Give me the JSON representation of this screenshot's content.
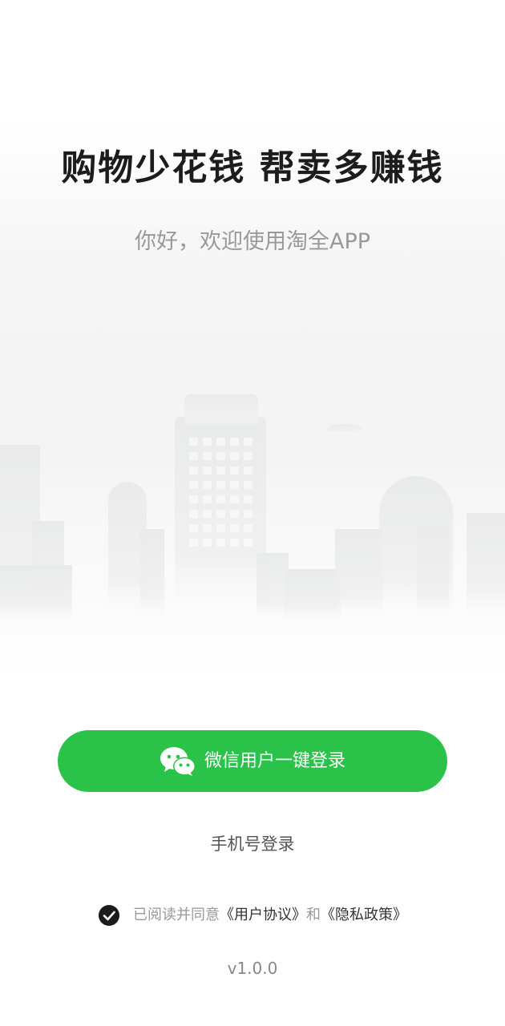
{
  "hero": {
    "headline": "购物少花钱 帮卖多赚钱",
    "subtitle": "你好，欢迎使用淘全APP"
  },
  "login": {
    "wechat_label": "微信用户一键登录",
    "wechat_icon": "wechat-icon",
    "phone_label": "手机号登录"
  },
  "agreement": {
    "checked": true,
    "prefix": "已阅读并同意",
    "user_agreement": "《用户协议》",
    "conjunction": "和",
    "privacy_policy": "《隐私政策》"
  },
  "version": "v1.0.0",
  "colors": {
    "primary_green": "#2bc24a",
    "headline": "#1c1c1c",
    "muted_text": "#999999"
  }
}
